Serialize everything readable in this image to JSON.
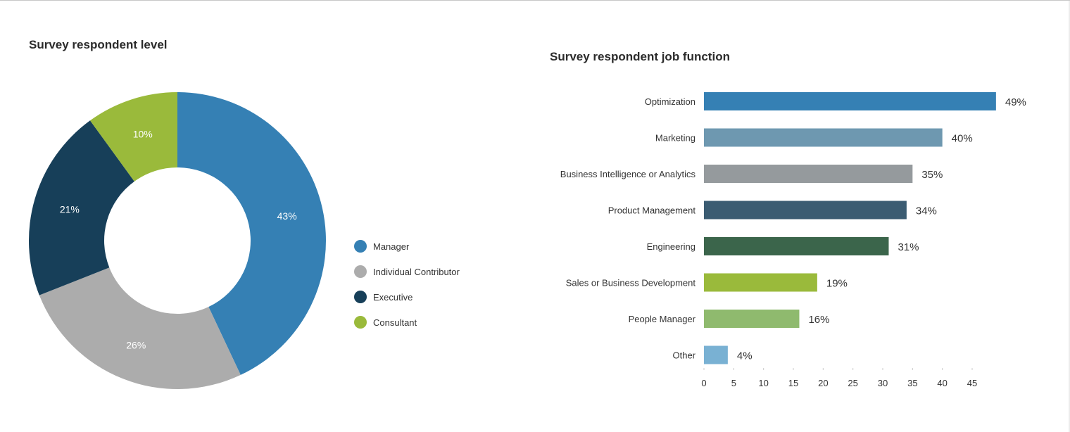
{
  "chart_data": [
    {
      "type": "pie",
      "title": "Survey respondent level",
      "donut": true,
      "categories": [
        "Manager",
        "Individual Contributor",
        "Executive",
        "Consultant"
      ],
      "values": [
        43,
        26,
        21,
        10
      ],
      "labels": [
        "43%",
        "26%",
        "21%",
        "10%"
      ],
      "colors": [
        "#3580b4",
        "#acacac",
        "#173f59",
        "#9aba3b"
      ],
      "legend": "right"
    },
    {
      "type": "bar",
      "orientation": "horizontal",
      "title": "Survey respondent job function",
      "categories": [
        "Optimization",
        "Marketing",
        "Business Intelligence or Analytics",
        "Product Management",
        "Engineering",
        "Sales or Business Development",
        "People Manager",
        "Other"
      ],
      "values": [
        49,
        40,
        35,
        34,
        31,
        19,
        16,
        4
      ],
      "labels": [
        "49%",
        "40%",
        "35%",
        "34%",
        "31%",
        "19%",
        "16%",
        "4%"
      ],
      "colors": [
        "#3580b4",
        "#6e98b0",
        "#959a9d",
        "#3b5c72",
        "#3b654b",
        "#9aba3b",
        "#8fba6e",
        "#79b1d3"
      ],
      "xticks": [
        "0",
        "5",
        "10",
        "15",
        "20",
        "25",
        "30",
        "35",
        "40",
        "45"
      ],
      "xlim": [
        0,
        45
      ],
      "xlabel": "",
      "ylabel": "",
      "grid": false
    }
  ]
}
